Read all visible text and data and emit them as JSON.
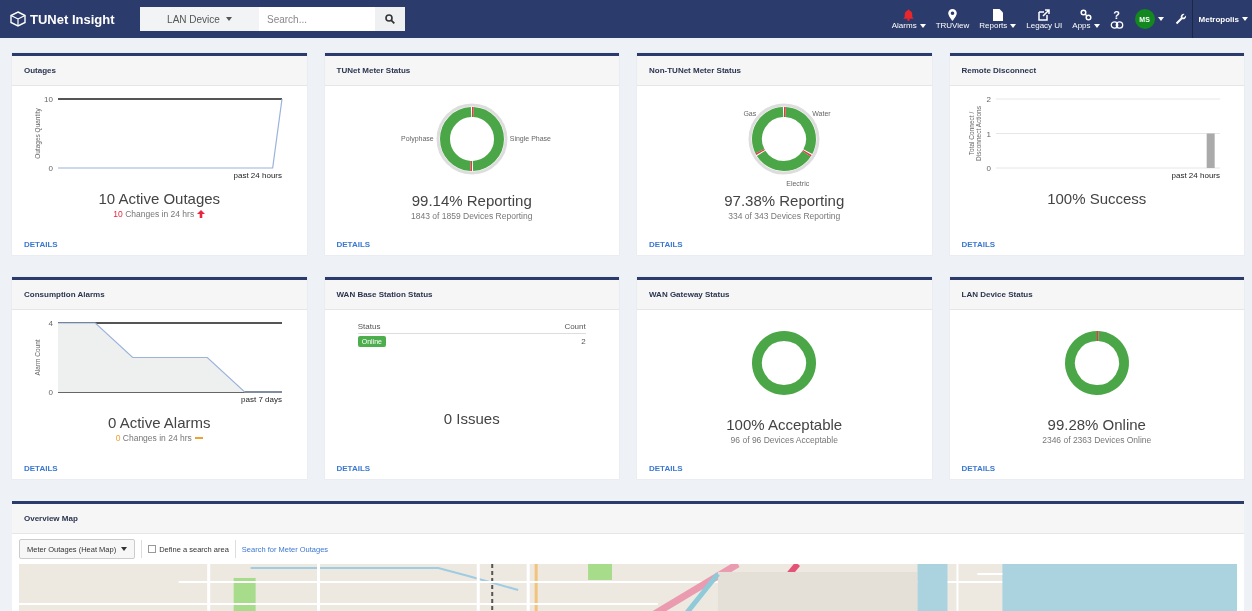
{
  "nav": {
    "brand": "TUNet Insight",
    "scope": "LAN Device",
    "search": {
      "placeholder": "Search..."
    },
    "items": [
      {
        "label": "Alarms",
        "caret": true,
        "alert": true
      },
      {
        "label": "TRUView",
        "caret": false,
        "alert": false
      },
      {
        "label": "Reports",
        "caret": true,
        "alert": false
      },
      {
        "label": "Legacy UI",
        "caret": false,
        "alert": false
      },
      {
        "label": "Apps",
        "caret": true,
        "alert": false
      },
      {
        "label": "?",
        "caret": false,
        "alert": false
      }
    ],
    "user": {
      "initials": "MS"
    },
    "tenant": "Metropolis"
  },
  "cards": [
    {
      "title": "Outages",
      "kind": "line",
      "chart_data": {
        "type": "line",
        "ylabel": "Outages Quantity",
        "xlabel": "past 24 hours",
        "categories": [
          null,
          null,
          null,
          null,
          null,
          null,
          null,
          null,
          null,
          null,
          null,
          null,
          null,
          null,
          null,
          null,
          null,
          null,
          null,
          null,
          null,
          null,
          null,
          null,
          null
        ],
        "series": [
          {
            "color": "#9bb2dc",
            "values": [
              0,
              0,
              0,
              0,
              0,
              0,
              0,
              0,
              0,
              0,
              0,
              0,
              0,
              0,
              0,
              0,
              0,
              0,
              0,
              0,
              0,
              0,
              0,
              0,
              10
            ]
          }
        ],
        "ylim": [
          0,
          10
        ],
        "yticks": [
          0,
          10
        ]
      },
      "headline": "10 Active Outages",
      "change": {
        "count": "10",
        "text": "Changes in 24 hrs",
        "kind": "up"
      },
      "link": "DETAILS"
    },
    {
      "title": "TUNet Meter Status",
      "kind": "donut",
      "labels": [
        "Polyphase",
        "Single Phase"
      ],
      "headline": "99.14% Reporting",
      "subline": "1843 of 1859 Devices Reporting",
      "link": "DETAILS"
    },
    {
      "title": "Non-TUNet Meter Status",
      "kind": "donut",
      "labels": [
        "Gas",
        "Water",
        "Electric"
      ],
      "headline": "97.38% Reporting",
      "subline": "334 of 343 Devices Reporting",
      "link": "DETAILS"
    },
    {
      "title": "Remote Disconnect",
      "kind": "bar",
      "chart_data": {
        "type": "bar",
        "ylabel": "Total Connect / Disconnect Actions",
        "xlabel": "past 24 hours",
        "categories": [
          null,
          null,
          null,
          null,
          null,
          null,
          null,
          null,
          null,
          null,
          null,
          null
        ],
        "series": [
          {
            "color": "#aaaaaa",
            "values": [
              0,
              0,
              0,
              0,
              0,
              0,
              0,
              0,
              0,
              0,
              0,
              1
            ]
          }
        ],
        "ylim": [
          0,
          2
        ],
        "yticks": [
          0,
          1,
          2
        ]
      },
      "headline": "100% Success",
      "link": "DETAILS"
    },
    {
      "title": "Consumption Alarms",
      "kind": "line",
      "chart_data": {
        "type": "area",
        "ylabel": "Alarm Count",
        "xlabel": "past 7 days",
        "categories": [
          null,
          null,
          null,
          null,
          null,
          null,
          null
        ],
        "series": [
          {
            "color": "#9bb2dc",
            "values": [
              4,
              4,
              2,
              2,
              2,
              0,
              0
            ]
          }
        ],
        "ylim": [
          0,
          4
        ],
        "yticks": [
          0,
          4
        ]
      },
      "headline": "0 Active Alarms",
      "change": {
        "count": "0",
        "text": "Changes in 24 hrs",
        "kind": "flat"
      },
      "link": "DETAILS"
    },
    {
      "title": "WAN Base Station Status",
      "kind": "table",
      "table": {
        "columns": [
          "Status",
          "Count"
        ],
        "rows": [
          {
            "status": "Online",
            "count": "2"
          }
        ]
      },
      "headline": "0 Issues",
      "link": "DETAILS"
    },
    {
      "title": "WAN Gateway Status",
      "kind": "donut",
      "headline": "100% Acceptable",
      "subline": "96 of 96 Devices Acceptable",
      "link": "DETAILS"
    },
    {
      "title": "LAN Device Status",
      "kind": "donut",
      "headline": "99.28% Online",
      "subline": "2346 of 2363 Devices Online",
      "link": "DETAILS"
    }
  ],
  "map": {
    "title": "Overview Map",
    "layer": "Meter Outages (Heat Map)",
    "define_area": {
      "label": "Define a search area",
      "checked": false
    },
    "search_link": "Search for Meter Outages",
    "kind": "picture"
  }
}
